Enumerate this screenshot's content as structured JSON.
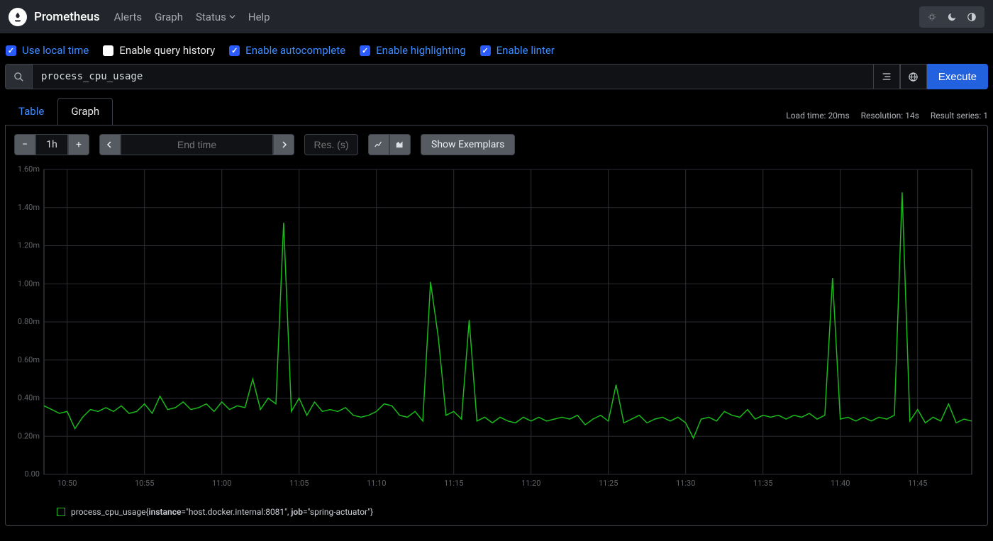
{
  "header": {
    "brand": "Prometheus",
    "nav": [
      "Alerts",
      "Graph",
      "Status",
      "Help"
    ]
  },
  "options": [
    {
      "label": "Use local time",
      "checked": true,
      "link": true
    },
    {
      "label": "Enable query history",
      "checked": false,
      "link": false
    },
    {
      "label": "Enable autocomplete",
      "checked": true,
      "link": true
    },
    {
      "label": "Enable highlighting",
      "checked": true,
      "link": true
    },
    {
      "label": "Enable linter",
      "checked": true,
      "link": true
    }
  ],
  "query": {
    "expression": "process_cpu_usage",
    "execute_label": "Execute"
  },
  "tabs": {
    "table": "Table",
    "graph": "Graph"
  },
  "stats": {
    "load": "Load time: 20ms",
    "resolution": "Resolution: 14s",
    "series": "Result series: 1"
  },
  "controls": {
    "range": "1h",
    "endtime_placeholder": "End time",
    "res_placeholder": "Res. (s)",
    "exemplars": "Show Exemplars"
  },
  "legend": {
    "metric": "process_cpu_usage",
    "labels": [
      [
        "instance",
        "host.docker.internal:8081"
      ],
      [
        "job",
        "spring-actuator"
      ]
    ]
  },
  "chart_data": {
    "type": "line",
    "xlabel": "",
    "ylabel": "",
    "ylim": [
      0,
      0.0016
    ],
    "y_ticks": [
      "0.00",
      "0.20m",
      "0.40m",
      "0.60m",
      "0.80m",
      "1.00m",
      "1.20m",
      "1.40m",
      "1.60m"
    ],
    "x_ticks": [
      "10:50",
      "10:55",
      "11:00",
      "11:05",
      "11:10",
      "11:15",
      "11:20",
      "11:25",
      "11:30",
      "11:35",
      "11:40",
      "11:45"
    ],
    "x_range": [
      0,
      60
    ],
    "series": [
      {
        "name": "process_cpu_usage",
        "x": [
          0,
          0.5,
          1,
          1.5,
          2,
          2.5,
          3,
          3.5,
          4,
          4.5,
          5,
          5.5,
          6,
          6.5,
          7,
          7.5,
          8,
          8.5,
          9,
          9.5,
          10,
          10.5,
          11,
          11.5,
          12,
          12.5,
          13,
          13.5,
          14,
          14.5,
          15,
          15.5,
          16,
          16.5,
          17,
          17.5,
          18,
          18.5,
          19,
          19.5,
          20,
          20.5,
          21,
          21.5,
          22,
          22.5,
          23,
          23.5,
          24,
          24.5,
          25,
          25.5,
          26,
          26.5,
          27,
          27.5,
          28,
          28.5,
          29,
          29.5,
          30,
          30.5,
          31,
          31.5,
          32,
          32.5,
          33,
          33.5,
          34,
          34.5,
          35,
          35.5,
          36,
          36.5,
          37,
          37.5,
          38,
          38.5,
          39,
          39.5,
          40,
          40.5,
          41,
          41.5,
          42,
          42.5,
          43,
          43.5,
          44,
          44.5,
          45,
          45.5,
          46,
          46.5,
          47,
          47.5,
          48,
          48.5,
          49,
          49.5,
          50,
          50.5,
          51,
          51.5,
          52,
          52.5,
          53,
          53.5,
          54,
          54.5,
          55,
          55.5,
          56,
          56.5,
          57,
          57.5,
          58,
          58.5,
          59,
          59.5,
          60
        ],
        "values": [
          0.00036,
          0.00034,
          0.00032,
          0.00033,
          0.00024,
          0.0003,
          0.00034,
          0.00033,
          0.00035,
          0.00033,
          0.00036,
          0.00032,
          0.00033,
          0.00037,
          0.00032,
          0.00041,
          0.00034,
          0.00035,
          0.00038,
          0.00034,
          0.00035,
          0.00037,
          0.00033,
          0.00038,
          0.00034,
          0.00036,
          0.00035,
          0.0005,
          0.00034,
          0.0004,
          0.00037,
          0.00132,
          0.00033,
          0.0004,
          0.00031,
          0.00038,
          0.00033,
          0.00034,
          0.00033,
          0.00035,
          0.00031,
          0.0003,
          0.00031,
          0.00033,
          0.00037,
          0.00036,
          0.00031,
          0.0003,
          0.00033,
          0.00028,
          0.00101,
          0.00072,
          0.00031,
          0.00033,
          0.00029,
          0.00081,
          0.00028,
          0.0003,
          0.00027,
          0.0003,
          0.00028,
          0.00027,
          0.0003,
          0.00028,
          0.0003,
          0.00028,
          0.00029,
          0.0003,
          0.00029,
          0.00031,
          0.00026,
          0.00029,
          0.00031,
          0.00028,
          0.00047,
          0.00027,
          0.00029,
          0.00031,
          0.00027,
          0.00029,
          0.0003,
          0.00028,
          0.0003,
          0.00027,
          0.00019,
          0.00029,
          0.0003,
          0.00028,
          0.00033,
          0.00031,
          0.0003,
          0.00034,
          0.00029,
          0.00031,
          0.0003,
          0.00031,
          0.00029,
          0.00031,
          0.0003,
          0.00032,
          0.00029,
          0.00031,
          0.00103,
          0.00029,
          0.0003,
          0.00028,
          0.0003,
          0.00028,
          0.0003,
          0.00029,
          0.00031,
          0.00148,
          0.00028,
          0.00034,
          0.00027,
          0.0003,
          0.00028,
          0.00037,
          0.00027,
          0.00029,
          0.00028
        ]
      }
    ]
  }
}
